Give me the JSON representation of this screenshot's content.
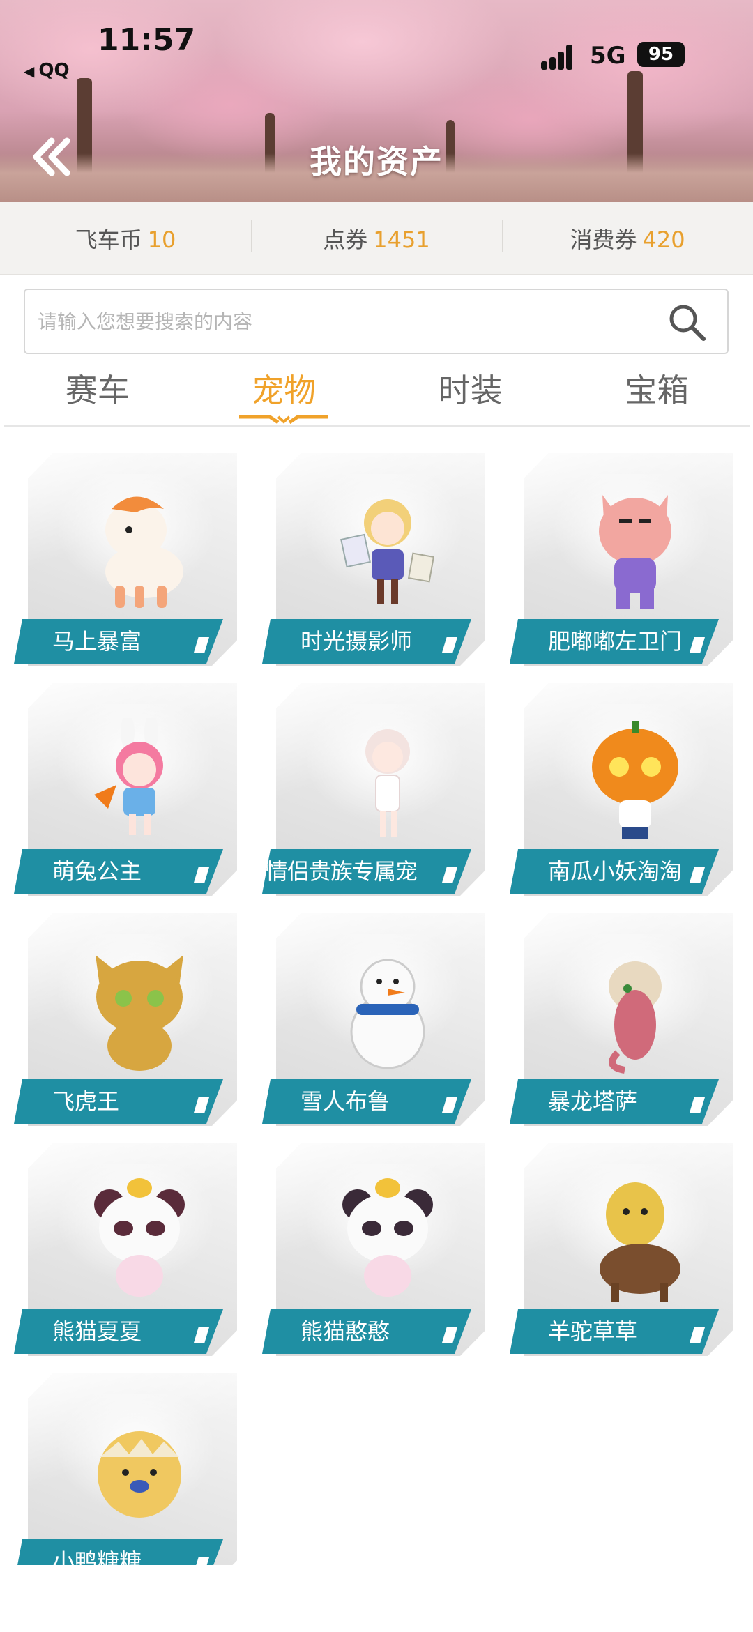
{
  "status_bar": {
    "time": "11:57",
    "back_app": "QQ",
    "network": "5G",
    "battery": "95"
  },
  "header": {
    "title": "我的资产",
    "back_icon": "double-chevron-left-icon"
  },
  "balances": [
    {
      "label": "飞车币",
      "value": "10"
    },
    {
      "label": "点券",
      "value": "1451"
    },
    {
      "label": "消费券",
      "value": "420"
    }
  ],
  "search": {
    "placeholder": "请输入您想要搜索的内容",
    "value": "",
    "icon": "search-icon"
  },
  "tabs": [
    {
      "label": "赛车",
      "active": false
    },
    {
      "label": "宠物",
      "active": true
    },
    {
      "label": "时装",
      "active": false
    },
    {
      "label": "宝箱",
      "active": false
    }
  ],
  "pets": [
    {
      "name": "马上暴富",
      "color": "#f28c3c",
      "kind": "horse"
    },
    {
      "name": "时光摄影师",
      "color": "#f2d079",
      "kind": "girl"
    },
    {
      "name": "肥嘟嘟左卫门",
      "color": "#f2a6a0",
      "kind": "pig"
    },
    {
      "name": "萌兔公主",
      "color": "#f47aa0",
      "kind": "bunny"
    },
    {
      "name": "情侣贵族专属宠",
      "color": "#f3e3e0",
      "kind": "doll"
    },
    {
      "name": "南瓜小妖淘淘",
      "color": "#f08a1c",
      "kind": "pumpkin"
    },
    {
      "name": "飞虎王",
      "color": "#d7a640",
      "kind": "tiger"
    },
    {
      "name": "雪人布鲁",
      "color": "#ffffff",
      "kind": "snowman"
    },
    {
      "name": "暴龙塔萨",
      "color": "#d06a7a",
      "kind": "dino"
    },
    {
      "name": "熊猫夏夏",
      "color": "#5a2b3a",
      "kind": "panda"
    },
    {
      "name": "熊猫憨憨",
      "color": "#3a2a38",
      "kind": "panda"
    },
    {
      "name": "羊驼草草",
      "color": "#e8c34a",
      "kind": "alpaca"
    },
    {
      "name": "小鸭糖糖",
      "color": "#f0c860",
      "kind": "duck"
    }
  ]
}
